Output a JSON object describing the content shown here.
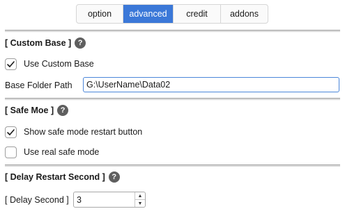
{
  "tabs": [
    {
      "label": "option",
      "active": false
    },
    {
      "label": "advanced",
      "active": true
    },
    {
      "label": "credit",
      "active": false
    },
    {
      "label": "addons",
      "active": false
    }
  ],
  "custom_base": {
    "title": "[ Custom Base ]",
    "help_icon": "question-mark-icon",
    "use_custom_base": {
      "label": "Use Custom Base",
      "checked": true
    },
    "base_folder": {
      "label": "Base Folder Path",
      "value": "G:\\UserName\\Data02"
    }
  },
  "safe_mode": {
    "title": "[ Safe Moe ]",
    "help_icon": "question-mark-icon",
    "show_restart_button": {
      "label": "Show safe mode restart button",
      "checked": true
    },
    "use_real_safe_mode": {
      "label": "Use real safe mode",
      "checked": false
    }
  },
  "delay_restart": {
    "title": "[ Delay Restart Second ]",
    "help_icon": "question-mark-icon",
    "delay_second": {
      "label": "[ Delay Second ]",
      "value": "3"
    }
  },
  "colors": {
    "accent": "#3b78d8",
    "help_icon_bg": "#5f5f5f",
    "input_focus_border": "#4a86d9"
  }
}
